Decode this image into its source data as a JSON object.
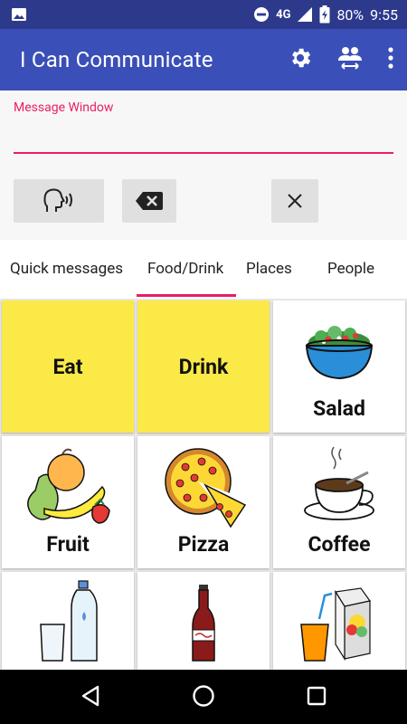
{
  "status_bar": {
    "network": "4G",
    "battery": "80%",
    "time": "9:55"
  },
  "app_bar": {
    "title": "I Can Communicate"
  },
  "message": {
    "label": "Message Window",
    "value": ""
  },
  "tabs": [
    {
      "label": "Quick messages"
    },
    {
      "label": "Food/Drink"
    },
    {
      "label": "Places"
    },
    {
      "label": "People"
    }
  ],
  "tiles": [
    {
      "label": "Eat"
    },
    {
      "label": "Drink"
    },
    {
      "label": "Salad"
    },
    {
      "label": "Fruit"
    },
    {
      "label": "Pizza"
    },
    {
      "label": "Coffee"
    },
    {
      "label": ""
    },
    {
      "label": ""
    },
    {
      "label": ""
    }
  ],
  "colors": {
    "status_bar": "#2d3a8c",
    "app_bar": "#3b4fb8",
    "accent": "#e91e63",
    "category_tile": "#fbe948"
  }
}
